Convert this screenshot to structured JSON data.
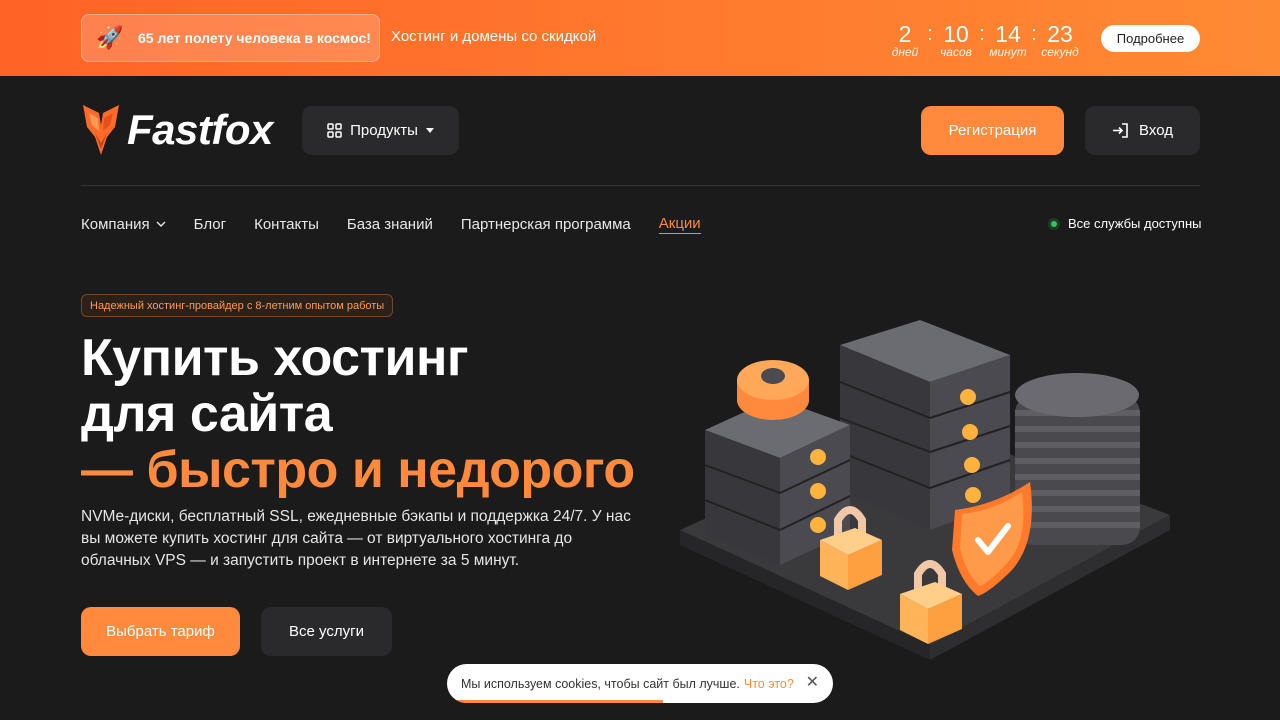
{
  "promo": {
    "icon": "rocket-icon",
    "badge_text": "65 лет полету человека в космос!",
    "subtitle": "Хостинг и домены со скидкой",
    "timer": [
      {
        "value": "2",
        "label": "дней"
      },
      {
        "value": "10",
        "label": "часов"
      },
      {
        "value": "14",
        "label": "минут"
      },
      {
        "value": "23",
        "label": "секунд"
      }
    ],
    "separator": ":",
    "more_label": "Подробнее"
  },
  "header": {
    "logo_text": "Fastfox",
    "products_label": "Продукты",
    "register_label": "Регистрация",
    "login_label": "Вход"
  },
  "nav": {
    "items": [
      {
        "label": "Компания"
      },
      {
        "label": "Блог"
      },
      {
        "label": "Контакты"
      },
      {
        "label": "База знаний"
      },
      {
        "label": "Партнерская программа"
      },
      {
        "label": "Акции"
      }
    ],
    "status_text": "Все службы доступны"
  },
  "hero": {
    "tag": "Надежный хостинг-провайдер с 8-летним опытом работы",
    "title_line1": "Купить хостинг",
    "title_line2": "для сайта",
    "title_line3": "— быстро и недорого",
    "description": "NVMe-диски, бесплатный SSL, ежедневные бэкапы и поддержка 24/7. У нас вы можете купить хостинг для сайта — от виртуального хостинга до облачных VPS — и запустить проект в интернете за 5 минут.",
    "choose_label": "Выбрать тариф",
    "services_label": "Все услуги"
  },
  "cookie": {
    "text": "Мы используем cookies, чтобы сайт был лучше.",
    "link": "Что это?",
    "close": "✕",
    "progress": 0.56
  },
  "colors": {
    "accent": "#ff8a3d",
    "promo_start": "#ff6326",
    "background": "#1b1b1c",
    "status_ok": "#34c759"
  }
}
